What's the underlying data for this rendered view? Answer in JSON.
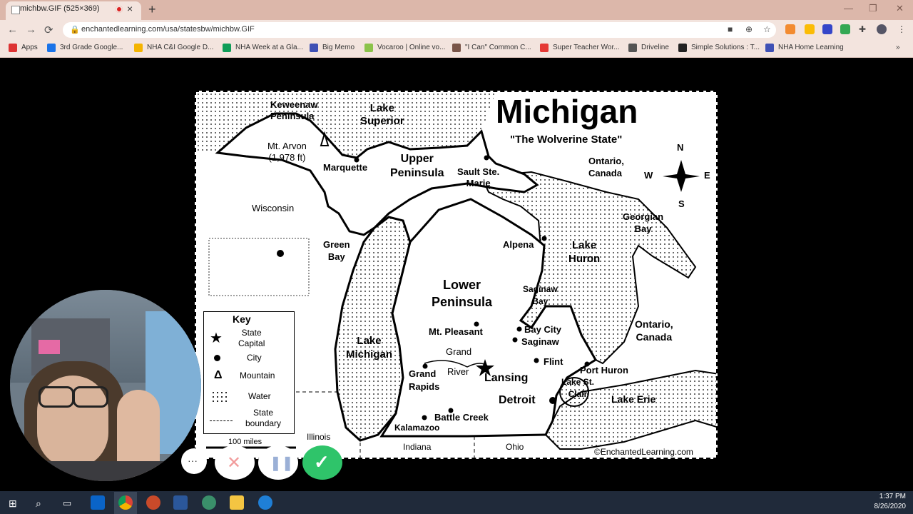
{
  "browser": {
    "tab_title": "michbw.GIF (525×369)",
    "tab_close": "×",
    "new_tab": "+",
    "url": "enchantedlearning.com/usa/statesbw/michbw.GIF",
    "nav": {
      "back": "←",
      "forward": "→",
      "reload": "⟳"
    },
    "window": {
      "minimize": "—",
      "restore": "❐",
      "close": "✕"
    },
    "bookmarks": [
      {
        "label": "Apps",
        "color": "#d33"
      },
      {
        "label": "3rd Grade Google...",
        "color": "#1a73e8"
      },
      {
        "label": "NHA C&I Google D...",
        "color": "#f4b400"
      },
      {
        "label": "NHA Week at a Gla...",
        "color": "#0f9d58"
      },
      {
        "label": "Big Memo",
        "color": "#3f51b5"
      },
      {
        "label": "Vocaroo | Online vo...",
        "color": "#8bc34a"
      },
      {
        "label": "\"I Can\" Common C...",
        "color": "#795548"
      },
      {
        "label": "Super Teacher Wor...",
        "color": "#e53935"
      },
      {
        "label": "Driveline",
        "color": "#555"
      },
      {
        "label": "Simple Solutions : T...",
        "color": "#222"
      },
      {
        "label": "NHA Home Learning",
        "color": "#3f51b5"
      }
    ],
    "bookmarks_more": "»"
  },
  "map": {
    "title": "Michigan",
    "subtitle": "\"The Wolverine State\"",
    "labels": {
      "keweenaw": "Keweenaw\nPeninsula",
      "lake_superior": "Lake\nSuperior",
      "mt_arvon": "Mt. Arvon\n(1,978 ft)",
      "marquette": "Marquette",
      "upper_peninsula": "Upper\nPeninsula",
      "sault": "Sault Ste.\nMarie",
      "ontario1": "Ontario,\nCanada",
      "wisconsin": "Wisconsin",
      "georgian_bay": "Georgian\nBay",
      "green_bay": "Green\nBay",
      "alpena": "Alpena",
      "lake_huron": "Lake\nHuron",
      "lower_peninsula": "Lower\nPeninsula",
      "saginaw_bay": "Saginaw\nBay",
      "mt_pleasant": "Mt. Pleasant",
      "bay_city": "Bay City",
      "saginaw": "Saginaw",
      "ontario2": "Ontario,\nCanada",
      "lake_michigan": "Lake\nMichigan",
      "grand": "Grand",
      "river": "River",
      "flint": "Flint",
      "port_huron": "Port Huron",
      "grand_rapids": "Grand\nRapids",
      "lansing": "Lansing",
      "lake_st_clair": "Lake St.\nClair",
      "detroit": "Detroit",
      "lake_erie": "Lake Erie",
      "battle_creek": "Battle Creek",
      "kalamazoo": "Kalamazoo",
      "illinois": "Illinois",
      "indiana": "Indiana",
      "ohio": "Ohio",
      "scale": "100 miles",
      "credit": "©EnchantedLearning.com"
    },
    "compass": {
      "n": "N",
      "s": "S",
      "e": "E",
      "w": "W"
    },
    "key": {
      "title": "Key",
      "items": [
        "State\nCapital",
        "City",
        "Mountain",
        "Water",
        "State\nboundary"
      ]
    }
  },
  "recorder": {
    "more": "···",
    "cancel": "✕",
    "pause": "❚❚",
    "done": "✓"
  },
  "taskbar": {
    "time": "1:37 PM",
    "date": "8/26/2020"
  }
}
